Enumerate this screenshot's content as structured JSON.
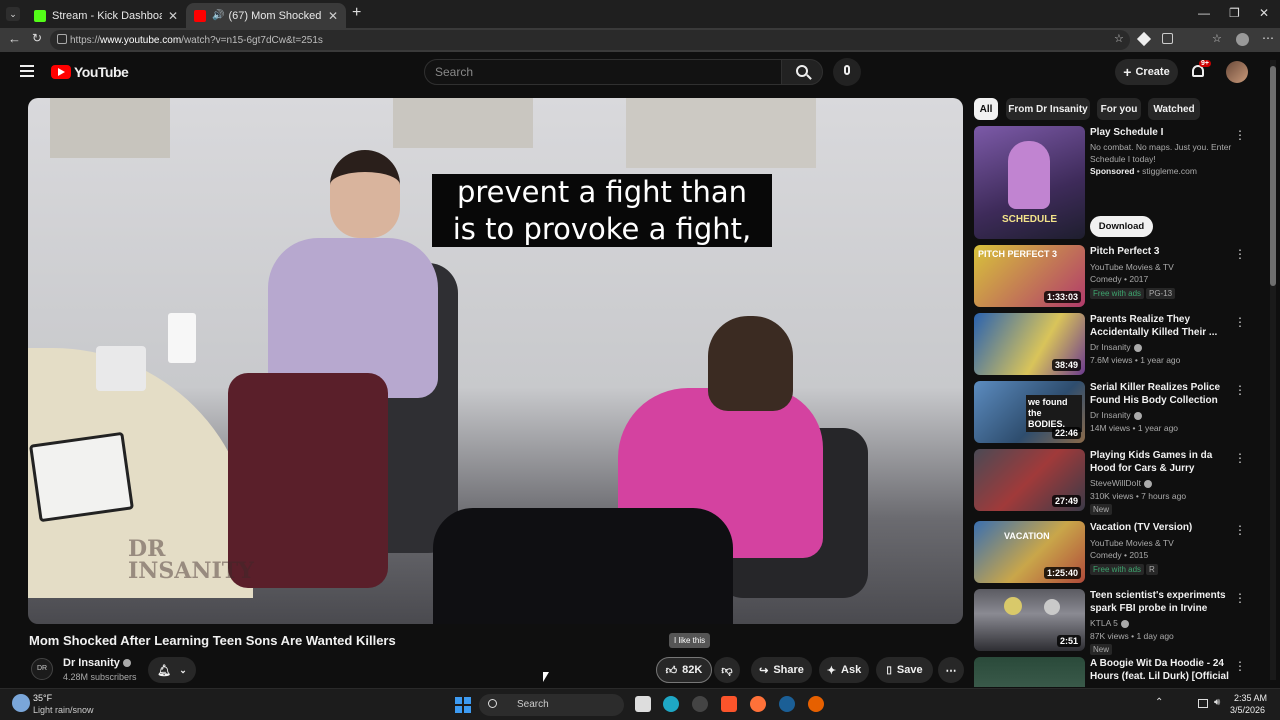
{
  "browser": {
    "tabs": [
      {
        "title": "Stream - Kick Dashboard",
        "active": false
      },
      {
        "title": "(67) Mom Shocked After Learn",
        "active": true
      }
    ],
    "url_prefix": "https://",
    "url_host": "www.youtube.com",
    "url_path": "/watch?v=n15-6gt7dCw&t=251s"
  },
  "yt_header": {
    "logo_text": "YouTube",
    "search_placeholder": "Search",
    "create_label": "Create",
    "notifications_badge": "9+"
  },
  "video": {
    "caption_line1": "prevent a fight than",
    "caption_line2": "is to provoke a fight,",
    "watermark": "DR INSANITY",
    "title": "Mom Shocked After Learning Teen Sons Are Wanted Killers",
    "channel_name": "Dr Insanity",
    "subscribers": "4.28M subscribers",
    "likes": "82K",
    "like_tooltip": "I like this",
    "share_label": "Share",
    "ask_label": "Ask",
    "save_label": "Save"
  },
  "sidebar": {
    "chips": [
      {
        "label": "All",
        "selected": true
      },
      {
        "label": "From Dr Insanity",
        "selected": false
      },
      {
        "label": "For you",
        "selected": false
      },
      {
        "label": "Watched",
        "selected": false
      }
    ],
    "sponsored": {
      "title": "Play Schedule I",
      "desc": "No combat. No maps. Just you. Enter Schedule I today!",
      "sponsor": "Sponsored",
      "domain": "stiggleme.com",
      "thumb_text": "SCHEDULE",
      "cta": "Download"
    },
    "items": [
      {
        "title": "Pitch Perfect 3",
        "channel": "YouTube Movies & TV",
        "meta": "Comedy • 2017",
        "duration": "1:33:03",
        "badge1": "Free with ads",
        "badge2": "PG-13",
        "thumb_text": "PITCH PERFECT 3"
      },
      {
        "title": "Parents Realize They Accidentally Killed Their ...",
        "channel": "Dr Insanity",
        "meta": "7.6M views • 1 year ago",
        "duration": "38:49",
        "badge1": "",
        "badge2": "",
        "thumb_text": ""
      },
      {
        "title": "Serial Killer Realizes Police Found His Body Collection",
        "channel": "Dr Insanity",
        "meta": "14M views • 1 year ago",
        "duration": "22:46",
        "badge1": "",
        "badge2": "",
        "thumb_text": "we found the BODIES."
      },
      {
        "title": "Playing Kids Games in da Hood for Cars & Jurry",
        "channel": "SteveWillDoIt",
        "meta": "310K views • 7 hours ago",
        "duration": "27:49",
        "badge1": "New",
        "badge2": "",
        "thumb_text": ""
      },
      {
        "title": "Vacation (TV Version)",
        "channel": "YouTube Movies & TV",
        "meta": "Comedy • 2015",
        "duration": "1:25:40",
        "badge1": "Free with ads",
        "badge2": "R",
        "thumb_text": "VACATION"
      },
      {
        "title": "Teen scientist's experiments spark FBI probe in Irvine",
        "channel": "KTLA 5",
        "meta": "87K views • 1 day ago",
        "duration": "2:51",
        "badge1": "New",
        "badge2": "",
        "thumb_text": ""
      },
      {
        "title": "A Boogie Wit Da Hoodie - 24 Hours (feat. Lil Durk) [Official ...",
        "channel": "",
        "meta": "",
        "duration": "",
        "badge1": "",
        "badge2": "",
        "thumb_text": ""
      }
    ]
  },
  "taskbar": {
    "temp": "35°F",
    "weather": "Light rain/snow",
    "search_label": "Search",
    "time": "2:35 AM",
    "date": "3/5/2026"
  },
  "colors": {
    "bg": "#0f0f0f",
    "brand_red": "#ff0000",
    "free_green": "#3ea6ff"
  }
}
